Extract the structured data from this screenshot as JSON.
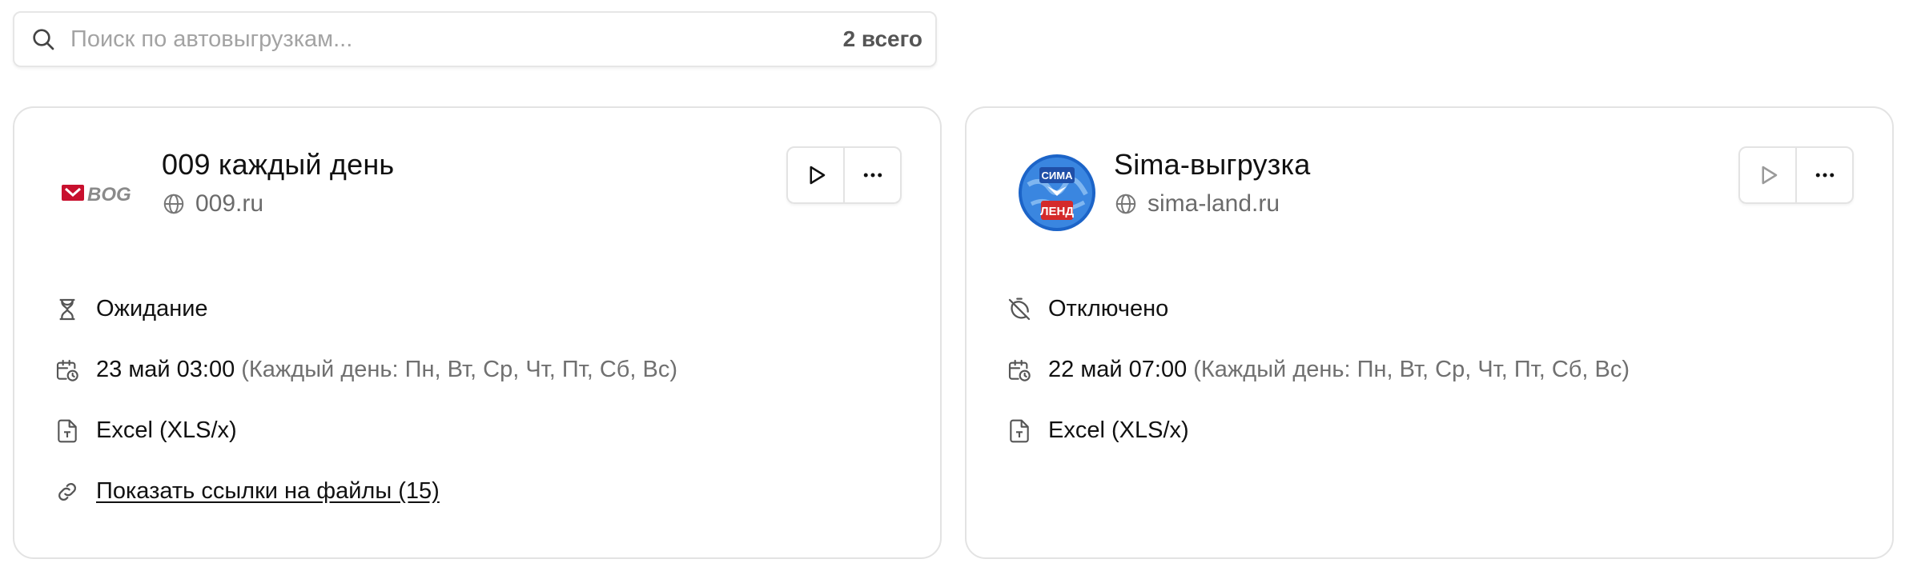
{
  "search": {
    "placeholder": "Поиск по автовыгрузкам...",
    "total": "2 всего"
  },
  "cards": [
    {
      "logo_text": "BOG",
      "title": "009 каждый день",
      "site": "009.ru",
      "status": "Ожидание",
      "status_icon": "hourglass-icon",
      "schedule_time": "23 май 03:00",
      "schedule_desc": "(Каждый день: Пн, Вт, Ср, Чт, Пт, Сб, Вс)",
      "format": "Excel (XLS/x)",
      "files_link": "Показать ссылки на файлы (15)"
    },
    {
      "logo_text_top": "СИМА",
      "logo_text_bottom": "ЛЕНД",
      "title": "Sima-выгрузка",
      "site": "sima-land.ru",
      "status": "Отключено",
      "status_icon": "timer-off-icon",
      "schedule_time": "22 май 07:00",
      "schedule_desc": "(Каждый день: Пн, Вт, Ср, Чт, Пт, Сб, Вс)",
      "format": "Excel (XLS/x)"
    }
  ],
  "colors": {
    "brand_red": "#c8102e",
    "sima_blue": "#1c64c8",
    "muted": "#707070",
    "border": "#e3e3e3"
  }
}
